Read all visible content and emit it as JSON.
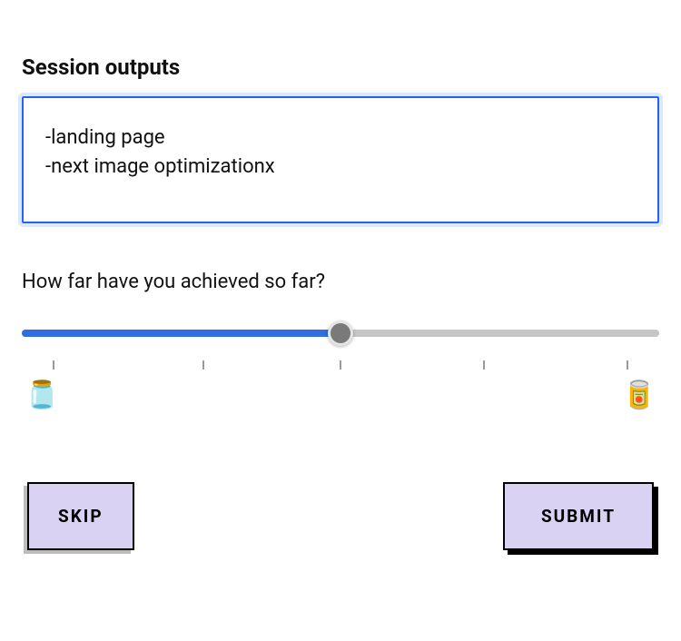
{
  "section": {
    "title": "Session outputs"
  },
  "outputs": {
    "value": "-landing page\n-next image optimizationx"
  },
  "slider": {
    "question": "How far have you achieved so far?",
    "value": 50,
    "min_icon": "jar",
    "max_icon": "can"
  },
  "buttons": {
    "skip": "SKIP",
    "submit": "SUBMIT"
  }
}
